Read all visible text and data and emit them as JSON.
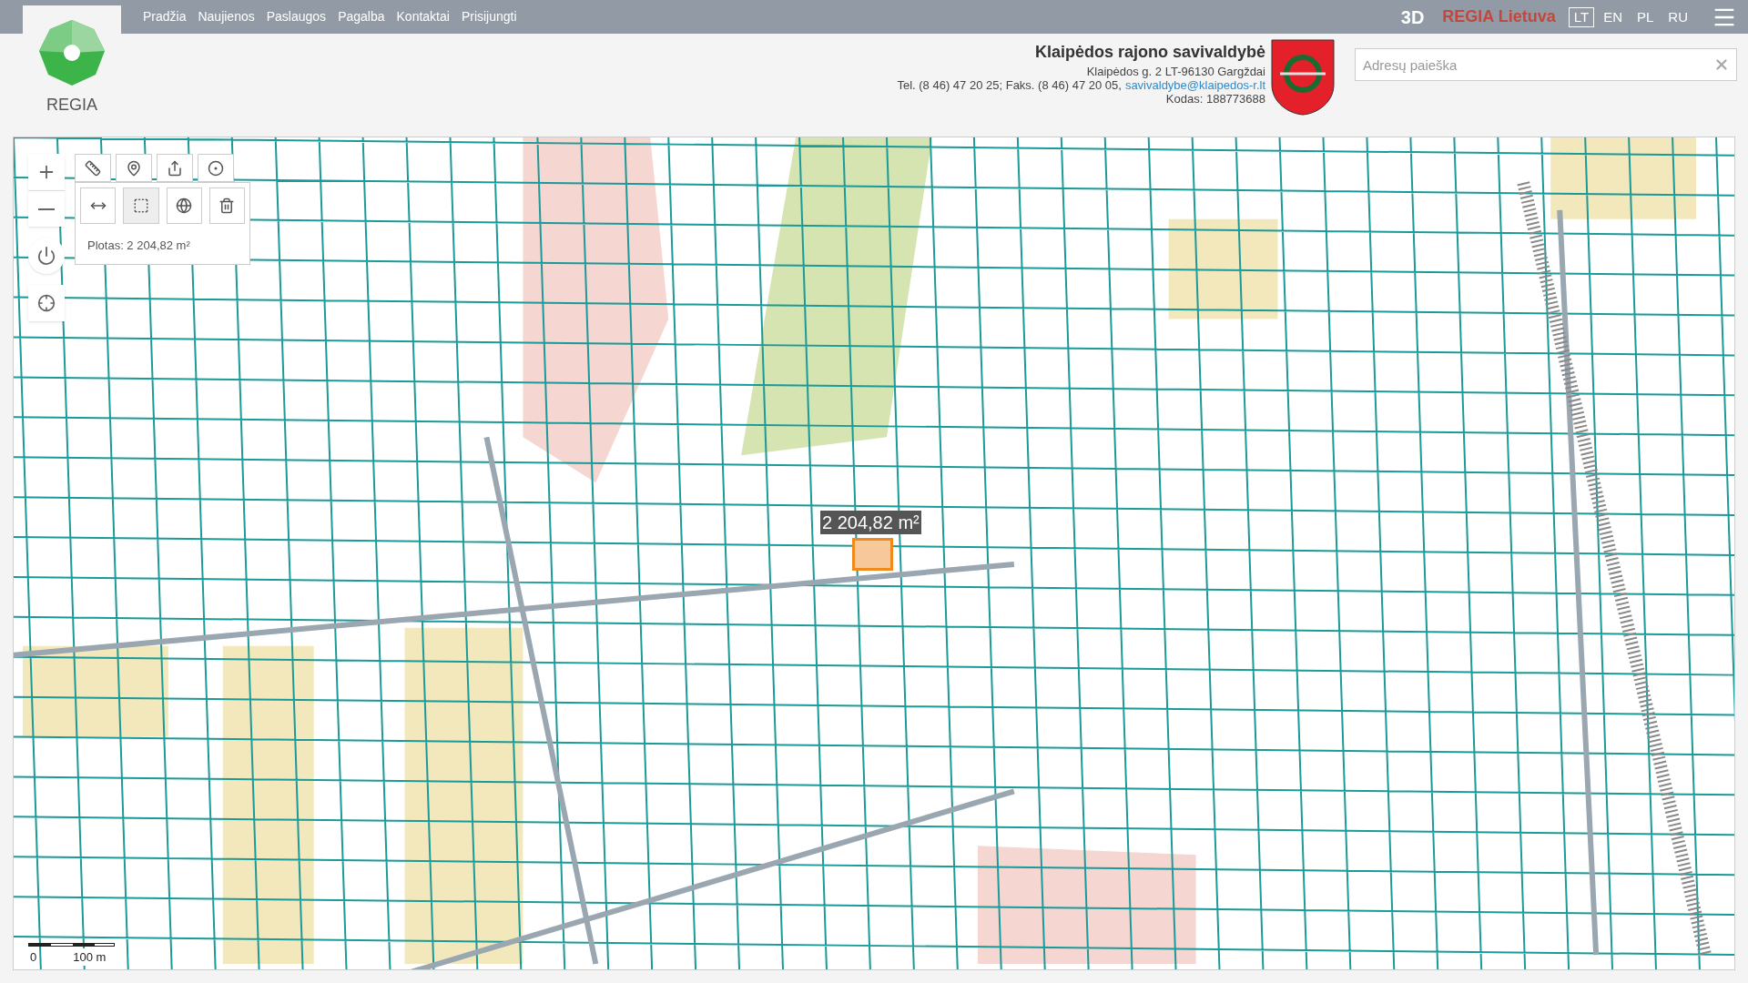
{
  "nav": {
    "links": [
      "Pradžia",
      "Naujienos",
      "Paslaugos",
      "Pagalba",
      "Kontaktai",
      "Prisijungti"
    ]
  },
  "logo": {
    "text": "REGIA"
  },
  "header_right": {
    "mode_3d": "3D",
    "brand": "REGIA Lietuva",
    "languages": [
      {
        "label": "LT",
        "selected": true
      },
      {
        "label": "EN",
        "selected": false
      },
      {
        "label": "PL",
        "selected": false
      },
      {
        "label": "RU",
        "selected": false
      }
    ]
  },
  "municipality": {
    "name": "Klaipėdos rajono savivaldybė",
    "address": "Klaipėdos g. 2 LT-96130 Gargždai",
    "phone_fax": "Tel. (8 46) 47 20 25; Faks. (8 46) 47 20 05,",
    "email": "savivaldybe@klaipedos-r.lt",
    "code": "Kodas: 188773688"
  },
  "search": {
    "placeholder": "Adresų paieška"
  },
  "map": {
    "tools": [
      {
        "kind": "ruler",
        "selected": false
      },
      {
        "kind": "marker",
        "selected": false
      },
      {
        "kind": "share",
        "selected": false
      },
      {
        "kind": "point",
        "selected": false
      }
    ],
    "measure_tools": [
      {
        "kind": "distance",
        "selected": false
      },
      {
        "kind": "area",
        "selected": true
      },
      {
        "kind": "globe",
        "selected": false
      },
      {
        "kind": "delete",
        "selected": false
      }
    ],
    "area_result": "Plotas: 2 204,82 m²",
    "area_label": "2 204,82 m²",
    "scale": {
      "zero": "0",
      "length": "100 m"
    }
  }
}
